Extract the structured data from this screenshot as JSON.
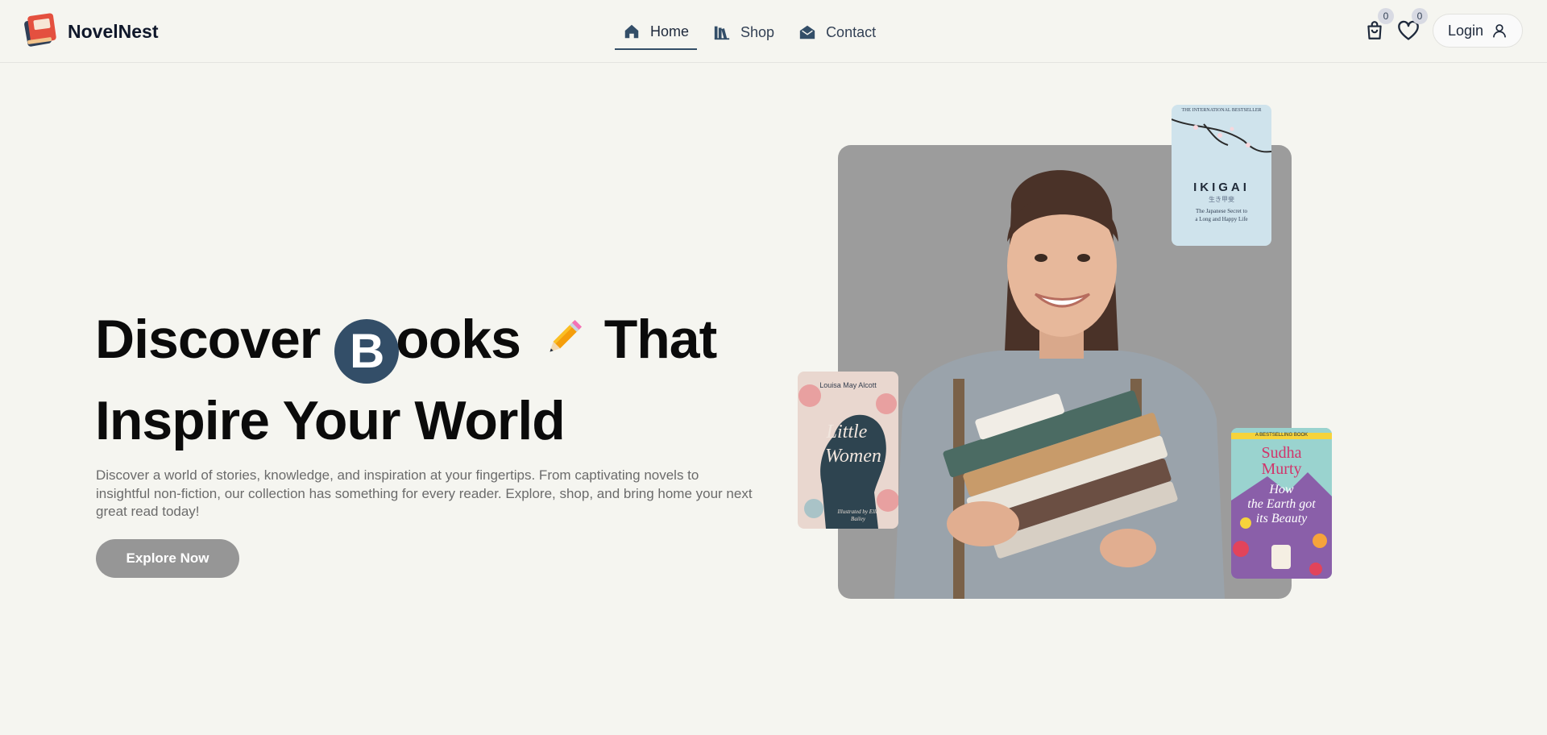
{
  "brand": {
    "name": "NovelNest",
    "logo_icon": "book-stack-logo-icon"
  },
  "nav": {
    "items": [
      {
        "label": "Home",
        "icon": "home-icon",
        "active": true
      },
      {
        "label": "Shop",
        "icon": "library-icon",
        "active": false
      },
      {
        "label": "Contact",
        "icon": "envelope-open-icon",
        "active": false
      }
    ]
  },
  "header_tools": {
    "cart_count": "0",
    "wishlist_count": "0",
    "login_label": "Login"
  },
  "hero": {
    "headline_word1": "Discover",
    "headline_b": "B",
    "headline_ooks": "ooks",
    "headline_that": "That",
    "headline_line2": "Inspire Your World",
    "description": "Discover a world of stories, knowledge, and inspiration at your fingertips. From captivating novels to insightful non-fiction, our collection has something for every reader. Explore, shop, and bring home your next great read today!",
    "cta_label": "Explore Now"
  },
  "books": {
    "ikigai": {
      "top": "THE INTERNATIONAL BESTSELLER",
      "title": "IKIGAI",
      "sub": "生き甲斐",
      "tag1": "The Japanese Secret to",
      "tag2": "a Long and Happy Life"
    },
    "little_women": {
      "author": "Louisa May Alcott",
      "title1": "Little",
      "title2": "Women",
      "illus": "Illustrated by Ella Bailey"
    },
    "murty": {
      "top": "A BESTSELLING BOOK",
      "author1": "Sudha",
      "author2": "Murty",
      "t1": "How",
      "t2": "the Earth got",
      "t3": "its Beauty"
    }
  },
  "colors": {
    "accent": "#334e68",
    "background": "#f5f5f0",
    "cta": "#969696",
    "photo_bg": "#9c9c9c"
  }
}
